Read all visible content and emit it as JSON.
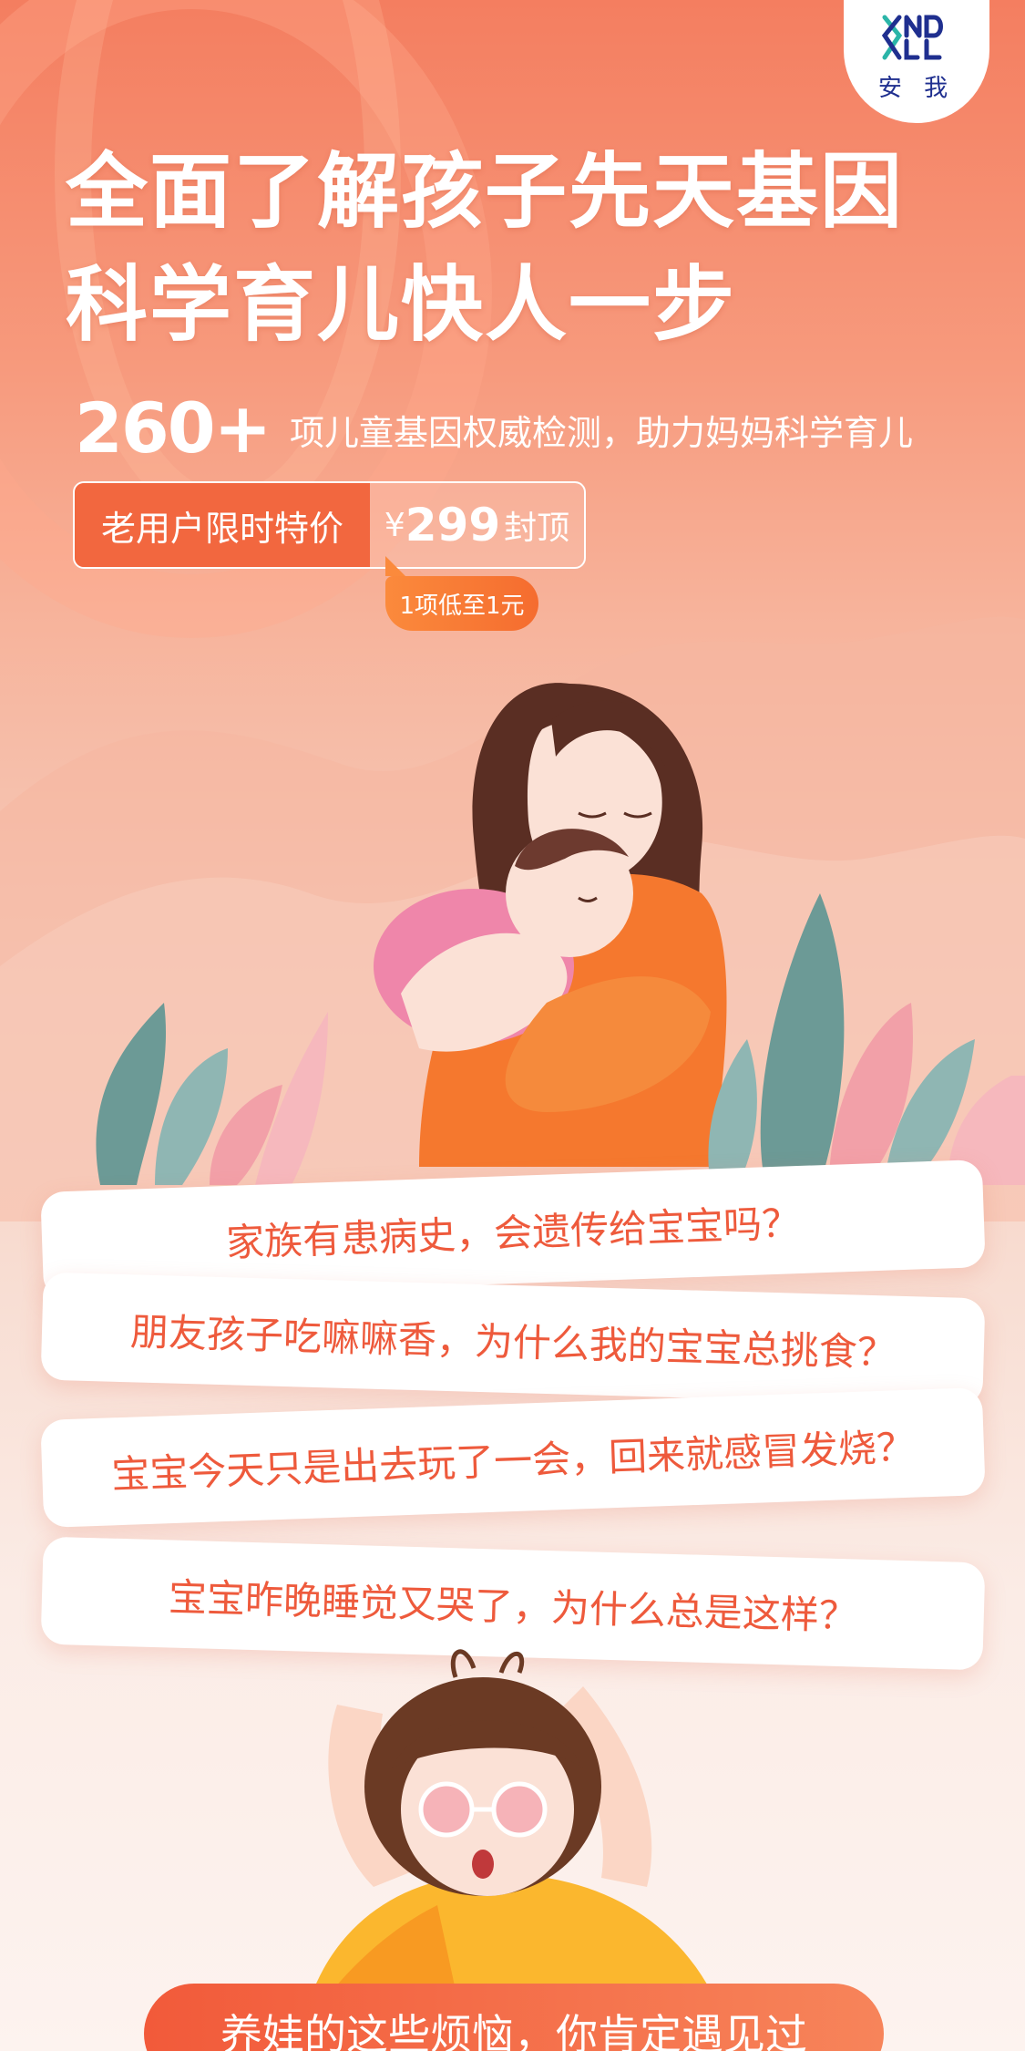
{
  "logo": {
    "mark": "ANDALL",
    "cn": "安 我"
  },
  "headline": {
    "line1": "全面了解孩子先天基因",
    "line2": "科学育儿快人一步"
  },
  "stat": {
    "number": "260+",
    "text": "项儿童基因权威检测，助力妈妈科学育儿"
  },
  "price": {
    "label": "老用户限时特价",
    "currency": "¥",
    "amount": "299",
    "suffix": "封顶",
    "tag": "1项低至1元"
  },
  "questions": [
    "家族有患病史，会遗传给宝宝吗？",
    "朋友孩子吃嘛嘛香，为什么我的宝宝总挑食？",
    "宝宝今天只是出去玩了一会，回来就感冒发烧？",
    "宝宝昨晚睡觉又哭了，为什么总是这样？"
  ],
  "footer": {
    "label": "养娃的这些烦恼，你肯定遇见过"
  },
  "colors": {
    "accent": "#f2673f",
    "card_text": "#ee5a3c",
    "logo": "#1f2f8f"
  },
  "illustrations": [
    "mother-holding-baby-illustration",
    "worried-mother-illustration",
    "plant-leaves-decoration"
  ]
}
